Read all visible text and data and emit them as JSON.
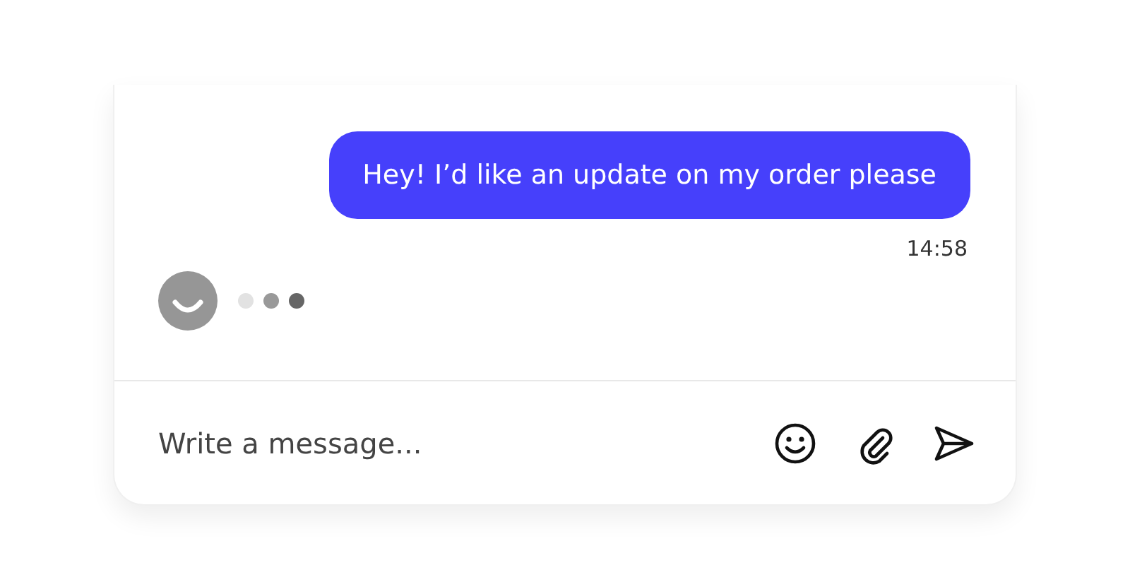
{
  "messages": [
    {
      "text": "Hey! I’d like an update on my order please",
      "time": "14:58"
    }
  ],
  "typing": {
    "on": true
  },
  "composer": {
    "placeholder": "Write a message..."
  }
}
